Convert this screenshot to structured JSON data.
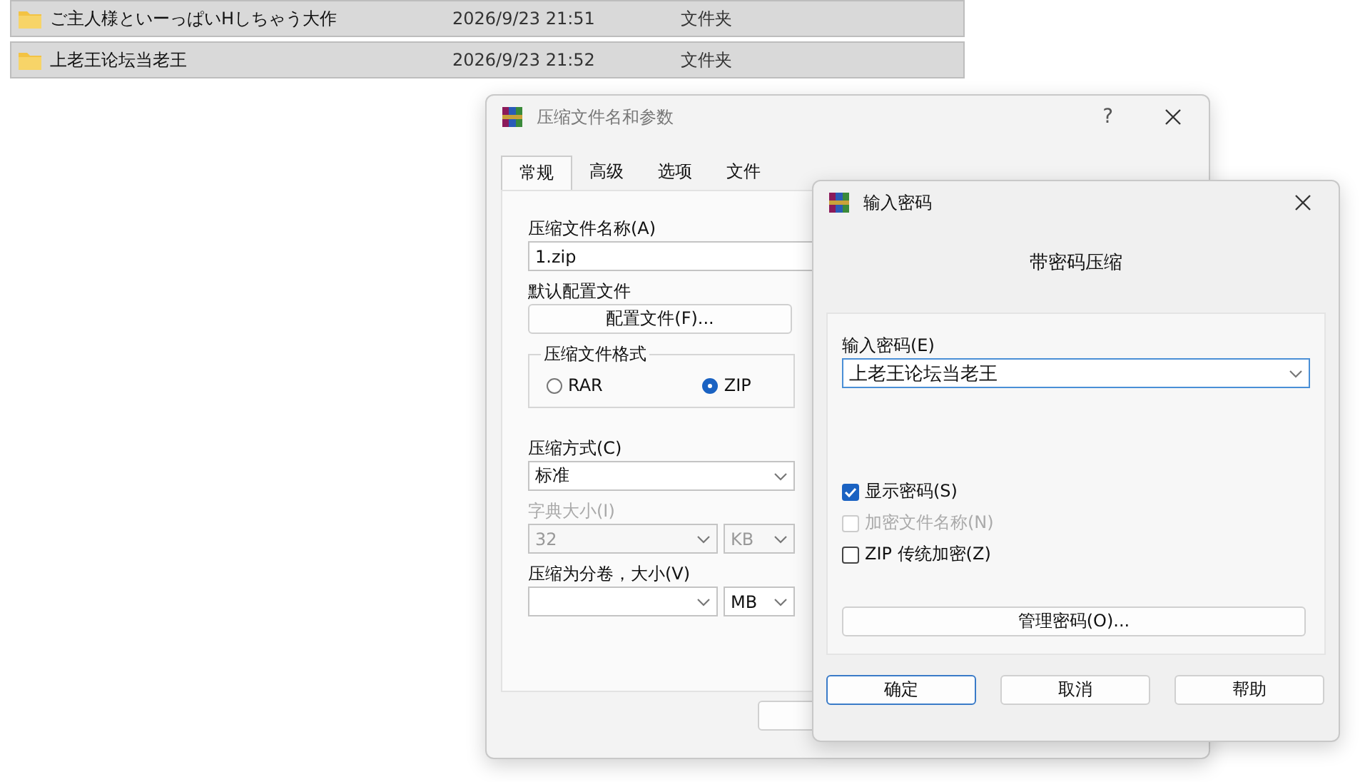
{
  "files": [
    {
      "name": "ご主人様といーっぱいHしちゃう大作",
      "date": "2026/9/23 21:51",
      "type": "文件夹"
    },
    {
      "name": "上老王论坛当老王",
      "date": "2026/9/23 21:52",
      "type": "文件夹"
    }
  ],
  "compress_dialog": {
    "title": "压缩文件名和参数",
    "help": "?",
    "tabs": [
      {
        "label": "常规",
        "selected": true
      },
      {
        "label": "高级",
        "selected": false
      },
      {
        "label": "选项",
        "selected": false
      },
      {
        "label": "文件",
        "selected": false
      }
    ],
    "archive_name_label": "压缩文件名称(A)",
    "archive_name_value": "1.zip",
    "profile_label": "默认配置文件",
    "profile_button": "配置文件(F)...",
    "format_group": {
      "legend": "压缩文件格式",
      "options": [
        {
          "label": "RAR",
          "selected": false
        },
        {
          "label": "ZIP",
          "selected": true
        }
      ]
    },
    "method_label": "压缩方式(C)",
    "method_value": "标准",
    "dictionary": {
      "label": "字典大小(I)",
      "value": "32",
      "unit": "KB",
      "disabled": true
    },
    "volume": {
      "label": "压缩为分卷，大小(V)",
      "unit": "MB",
      "disabled": false
    }
  },
  "password_dialog": {
    "title": "输入密码",
    "heading": "带密码压缩",
    "password_label": "输入密码(E)",
    "password_value": "上老王论坛当老王",
    "checkboxes": [
      {
        "label": "显示密码(S)",
        "checked": true,
        "disabled": false
      },
      {
        "label": "加密文件名称(N)",
        "checked": false,
        "disabled": true
      },
      {
        "label": "ZIP 传统加密(Z)",
        "checked": false,
        "disabled": false
      }
    ],
    "manage_button": "管理密码(O)...",
    "buttons": [
      {
        "label": "确定",
        "default": true
      },
      {
        "label": "取消",
        "default": false
      },
      {
        "label": "帮助",
        "default": false
      }
    ]
  }
}
